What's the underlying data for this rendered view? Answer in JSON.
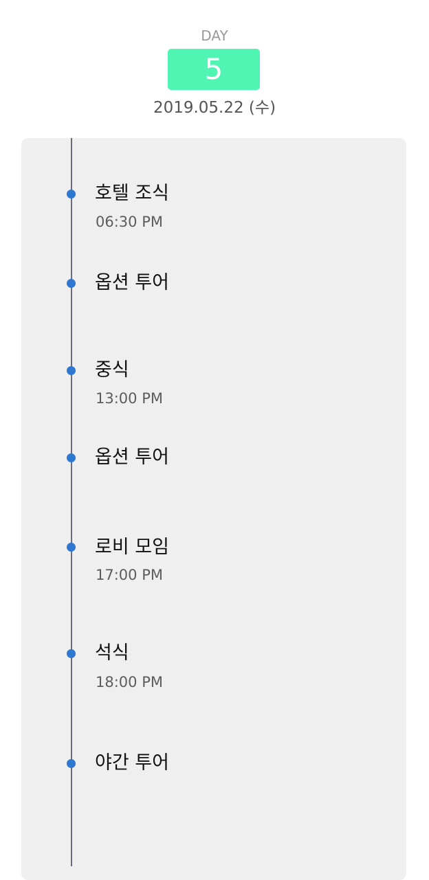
{
  "header": {
    "day_label": "DAY",
    "day_number": "5",
    "date": "2019.05.22 (수)"
  },
  "colors": {
    "badge": "#50f5b3",
    "dot": "#2f78d2",
    "line": "#6b6b7a",
    "card": "#efefef"
  },
  "events": [
    {
      "title": "호텔 조식",
      "time": "06:30 PM"
    },
    {
      "title": "옵션 투어",
      "time": ""
    },
    {
      "title": "중식",
      "time": "13:00 PM"
    },
    {
      "title": "옵션 투어",
      "time": ""
    },
    {
      "title": "로비 모임",
      "time": "17:00 PM"
    },
    {
      "title": "석식",
      "time": "18:00 PM"
    },
    {
      "title": "야간 투어",
      "time": ""
    }
  ]
}
